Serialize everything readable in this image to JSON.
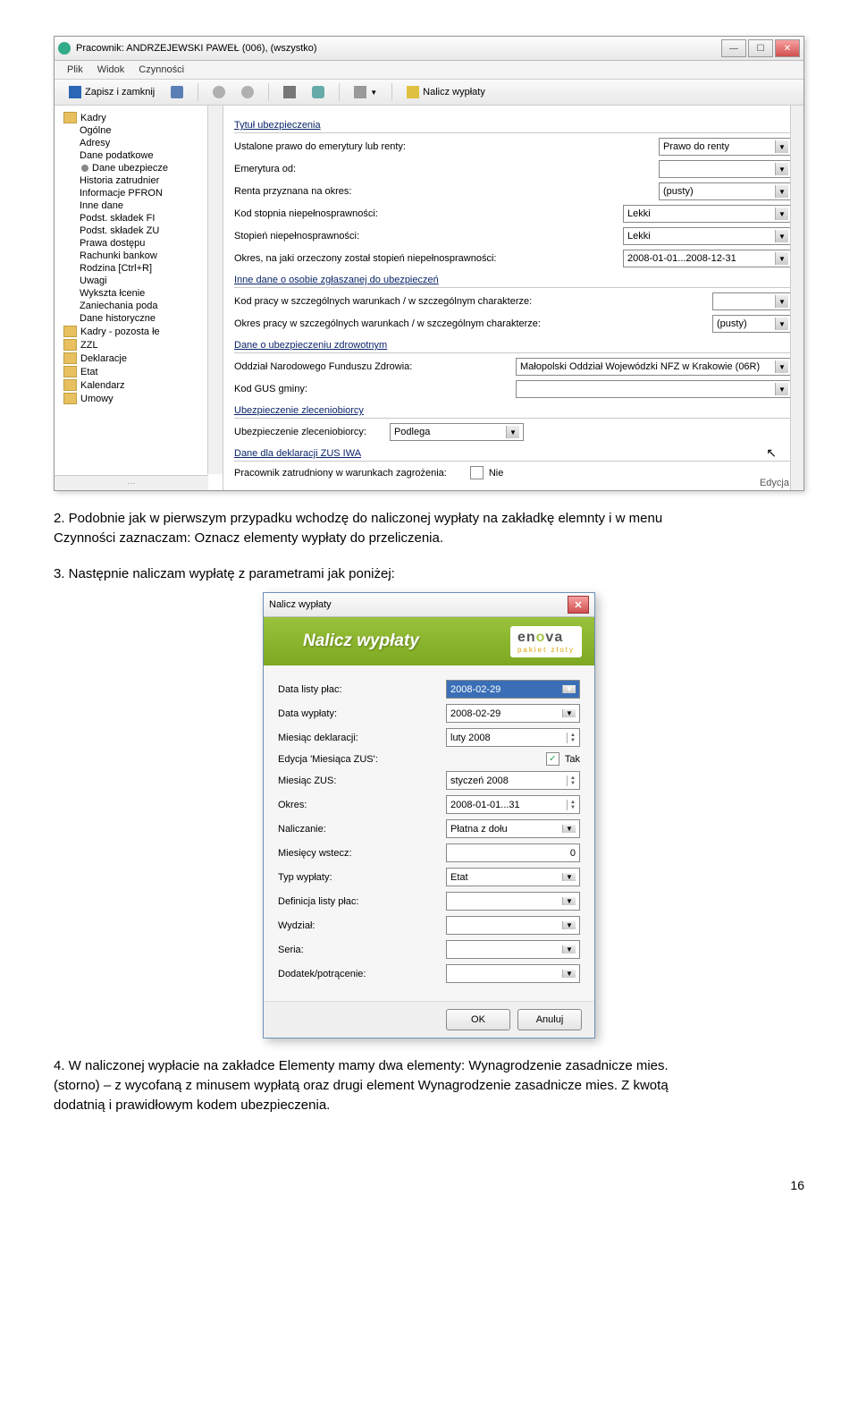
{
  "main_window": {
    "title": "Pracownik: ANDRZEJEWSKI PAWEŁ (006), (wszystko)",
    "menu": {
      "plik": "Plik",
      "widok": "Widok",
      "czynnosci": "Czynności"
    },
    "toolbar": {
      "save_close": "Zapisz i zamknij",
      "calc": "Nalicz wypłaty"
    },
    "tree": {
      "root": "Kadry",
      "items": [
        "Ogólne",
        "Adresy",
        "Dane podatkowe",
        "Dane ubezpiecze",
        "Historia zatrudnier",
        "Informacje PFRON",
        "Inne dane",
        "Podst. składek FI",
        "Podst. składek ZU",
        "Prawa dostępu",
        "Rachunki bankow",
        "Rodzina [Ctrl+R]",
        "Uwagi",
        "Wykszta łcenie",
        "Zaniechania poda",
        "Dane historyczne"
      ],
      "folders": [
        "Kadry - pozosta łe",
        "ZZL",
        "Deklaracje",
        "Etat",
        "Kalendarz",
        "Umowy"
      ]
    },
    "form": {
      "group_title": "Tytuł ubezpieczenia",
      "r1_label": "Ustalone prawo do emerytury lub renty:",
      "r1_val": "Prawo do renty",
      "r2_label": "Emerytura od:",
      "r3_label": "Renta przyznana na okres:",
      "r3_val": "(pusty)",
      "r4_label": "Kod stopnia niepełnosprawności:",
      "r4_val": "Lekki",
      "r5_label": "Stopień niepełnosprawności:",
      "r5_val": "Lekki",
      "r6_label": "Okres, na jaki orzeczony został stopień niepełnosprawności:",
      "r6_val": "2008-01-01...2008-12-31",
      "group2": "Inne dane o osobie zgłaszanej do ubezpieczeń",
      "r7_label": "Kod pracy w szczególnych warunkach / w szczególnym charakterze:",
      "r8_label": "Okres pracy w szczególnych warunkach / w szczególnym charakterze:",
      "r8_val": "(pusty)",
      "group3": "Dane o ubezpieczeniu zdrowotnym",
      "r9_label": "Oddział Narodowego Funduszu Zdrowia:",
      "r9_val": "Małopolski Oddział Wojewódzki NFZ w Krakowie (06R)",
      "r10_label": "Kod GUS gminy:",
      "group4": "Ubezpieczenie zleceniobiorcy",
      "r11_label": "Ubezpieczenie zleceniobiorcy:",
      "r11_val": "Podlega",
      "group5": "Dane dla deklaracji ZUS IWA",
      "r12_label": "Pracownik zatrudniony w warunkach zagrożenia:",
      "r12_val": "Nie",
      "status": "Edycja"
    }
  },
  "para2": "2.  Podobnie jak w pierwszym przypadku wchodzę do naliczonej wypłaty na zakładkę elemnty i w menu Czynności  zaznaczam: Oznacz elementy wypłaty do przeliczenia.",
  "para3": "3.   Następnie naliczam wypłatę z parametrami jak poniżej:",
  "dialog": {
    "title": "Nalicz wypłaty",
    "banner": "Nalicz wypłaty",
    "brand": "enova",
    "brand_sub": "pakiet złoty",
    "rows": {
      "r1_l": "Data listy płac:",
      "r1_v": "2008-02-29",
      "r2_l": "Data wypłaty:",
      "r2_v": "2008-02-29",
      "r3_l": "Miesiąc deklaracji:",
      "r3_v": "luty 2008",
      "r4_l": "Edycja 'Miesiąca ZUS':",
      "r4_v": "Tak",
      "r5_l": "Miesiąc ZUS:",
      "r5_v": "styczeń 2008",
      "r6_l": "Okres:",
      "r6_v": "2008-01-01...31",
      "r7_l": "Naliczanie:",
      "r7_v": "Płatna z dołu",
      "r8_l": "Miesięcy wstecz:",
      "r8_v": "0",
      "r9_l": "Typ wypłaty:",
      "r9_v": "Etat",
      "r10_l": "Definicja listy płac:",
      "r11_l": "Wydział:",
      "r12_l": "Seria:",
      "r13_l": "Dodatek/potrącenie:"
    },
    "ok": "OK",
    "cancel": "Anuluj"
  },
  "para4": "4.  W naliczonej wypłacie na zakładce Elementy mamy dwa elementy: Wynagrodzenie zasadnicze mies. (storno) – z wycofaną z minusem wypłatą oraz drugi element Wynagrodzenie zasadnicze mies. Z kwotą dodatnią i prawidłowym kodem ubezpieczenia.",
  "page_no": "16"
}
